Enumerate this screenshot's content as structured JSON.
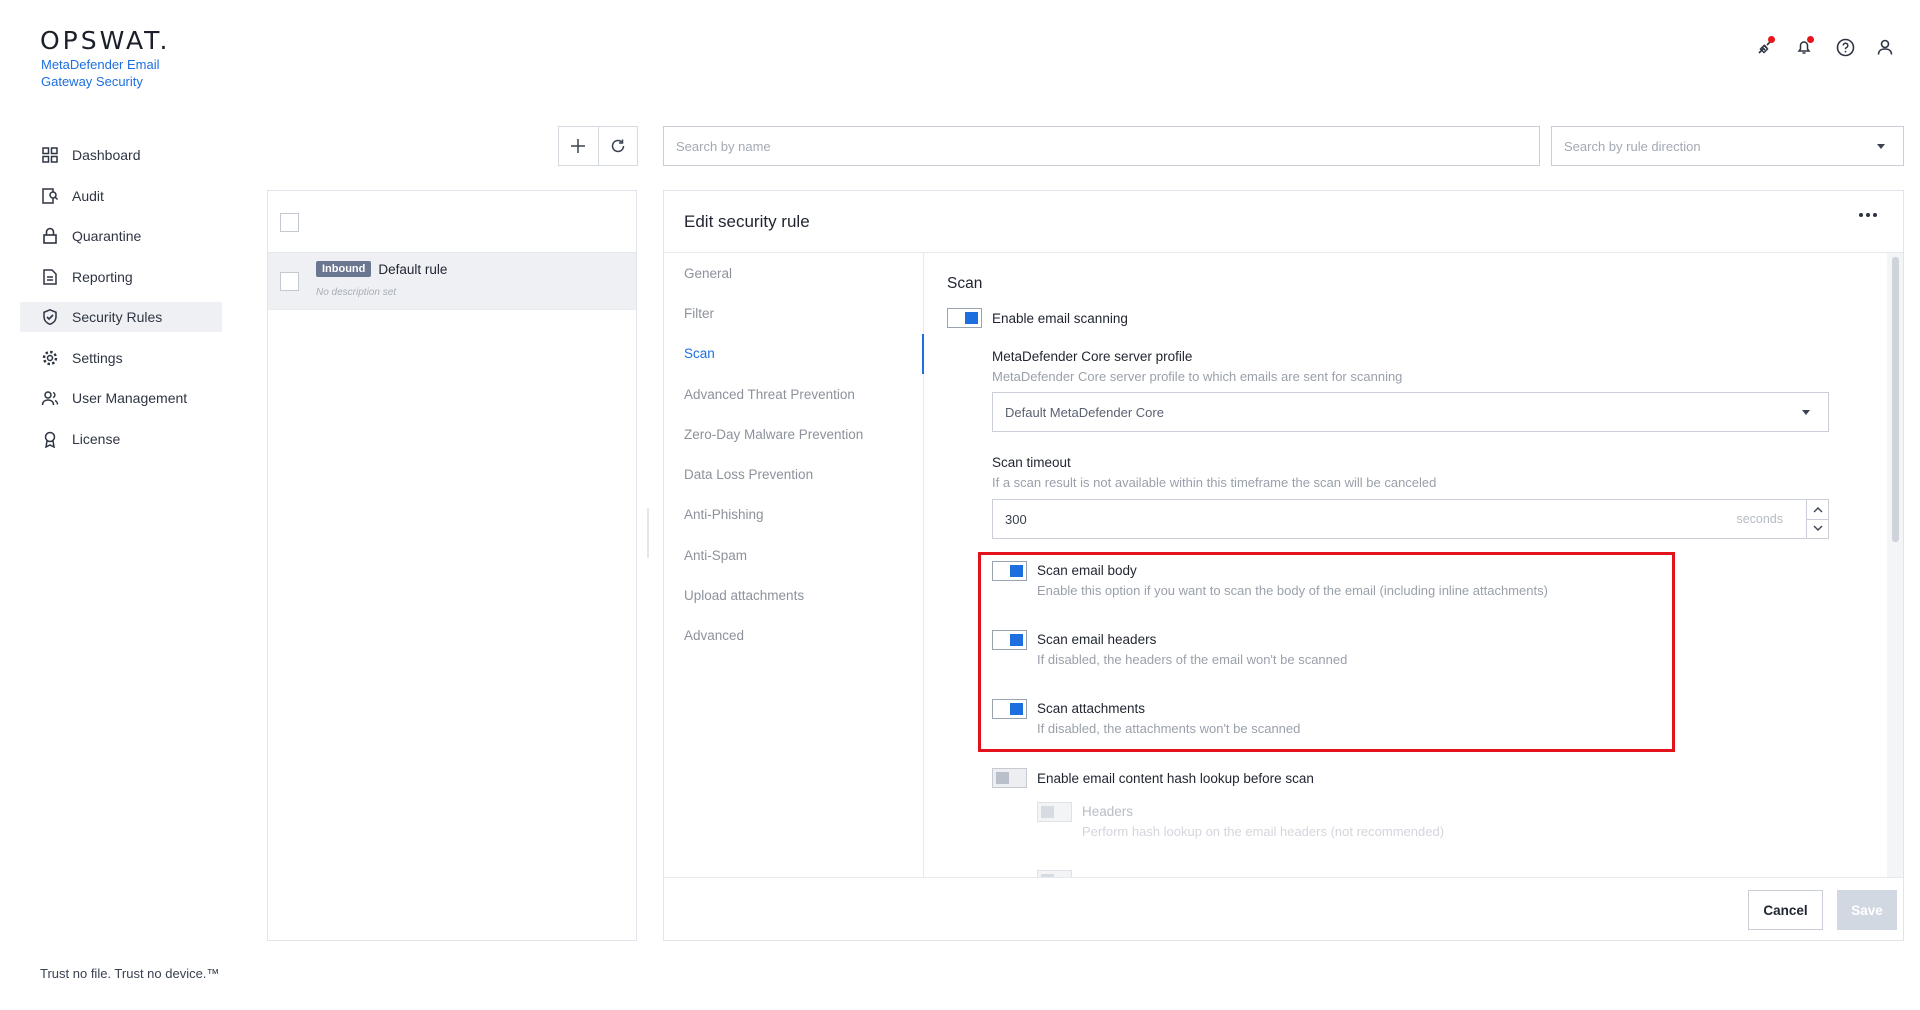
{
  "brand": {
    "logo": "OPSWAT.",
    "product": "MetaDefender Email Gateway Security",
    "tagline": "Trust no file. Trust no device.™"
  },
  "header_icons": [
    "integration-icon",
    "bell-icon",
    "help-icon",
    "user-icon"
  ],
  "sidebar": {
    "items": [
      {
        "label": "Dashboard",
        "icon": "dashboard-icon"
      },
      {
        "label": "Audit",
        "icon": "audit-icon"
      },
      {
        "label": "Quarantine",
        "icon": "lock-icon"
      },
      {
        "label": "Reporting",
        "icon": "report-icon"
      },
      {
        "label": "Security Rules",
        "icon": "shield-check-icon",
        "active": true
      },
      {
        "label": "Settings",
        "icon": "gear-icon"
      },
      {
        "label": "User Management",
        "icon": "users-icon"
      },
      {
        "label": "License",
        "icon": "license-icon"
      }
    ]
  },
  "search": {
    "name_placeholder": "Search by name",
    "direction_placeholder": "Search by rule direction"
  },
  "rules": [
    {
      "direction": "Inbound",
      "name": "Default rule",
      "description": "No description set"
    }
  ],
  "edit": {
    "title": "Edit security rule",
    "tabs": [
      "General",
      "Filter",
      "Scan",
      "Advanced Threat Prevention",
      "Zero-Day Malware Prevention",
      "Data Loss Prevention",
      "Anti-Phishing",
      "Anti-Spam",
      "Upload attachments",
      "Advanced"
    ],
    "active_tab": "Scan",
    "section_title": "Scan",
    "enable_scanning": {
      "label": "Enable email scanning",
      "on": true
    },
    "server_profile": {
      "title": "MetaDefender Core server profile",
      "desc": "MetaDefender Core server profile to which emails are sent for scanning",
      "value": "Default MetaDefender Core"
    },
    "timeout": {
      "title": "Scan timeout",
      "desc": "If a scan result is not available within this timeframe the scan will be canceled",
      "value": "300",
      "unit": "seconds"
    },
    "options": [
      {
        "title": "Scan email body",
        "desc": "Enable this option if you want to scan the body of the email (including inline attachments)",
        "on": true
      },
      {
        "title": "Scan email headers",
        "desc": "If disabled, the headers of the email won't be scanned",
        "on": true
      },
      {
        "title": "Scan attachments",
        "desc": "If disabled, the attachments won't be scanned",
        "on": true
      }
    ],
    "hash_lookup": {
      "label": "Enable email content hash lookup before scan",
      "on": false
    },
    "hash_headers": {
      "label": "Headers",
      "desc": "Perform hash lookup on the email headers (not recommended)"
    },
    "buttons": {
      "cancel": "Cancel",
      "save": "Save"
    }
  },
  "colors": {
    "accent": "#1d6fe0",
    "highlight": "#e3111b",
    "badge": "#6b7690"
  }
}
